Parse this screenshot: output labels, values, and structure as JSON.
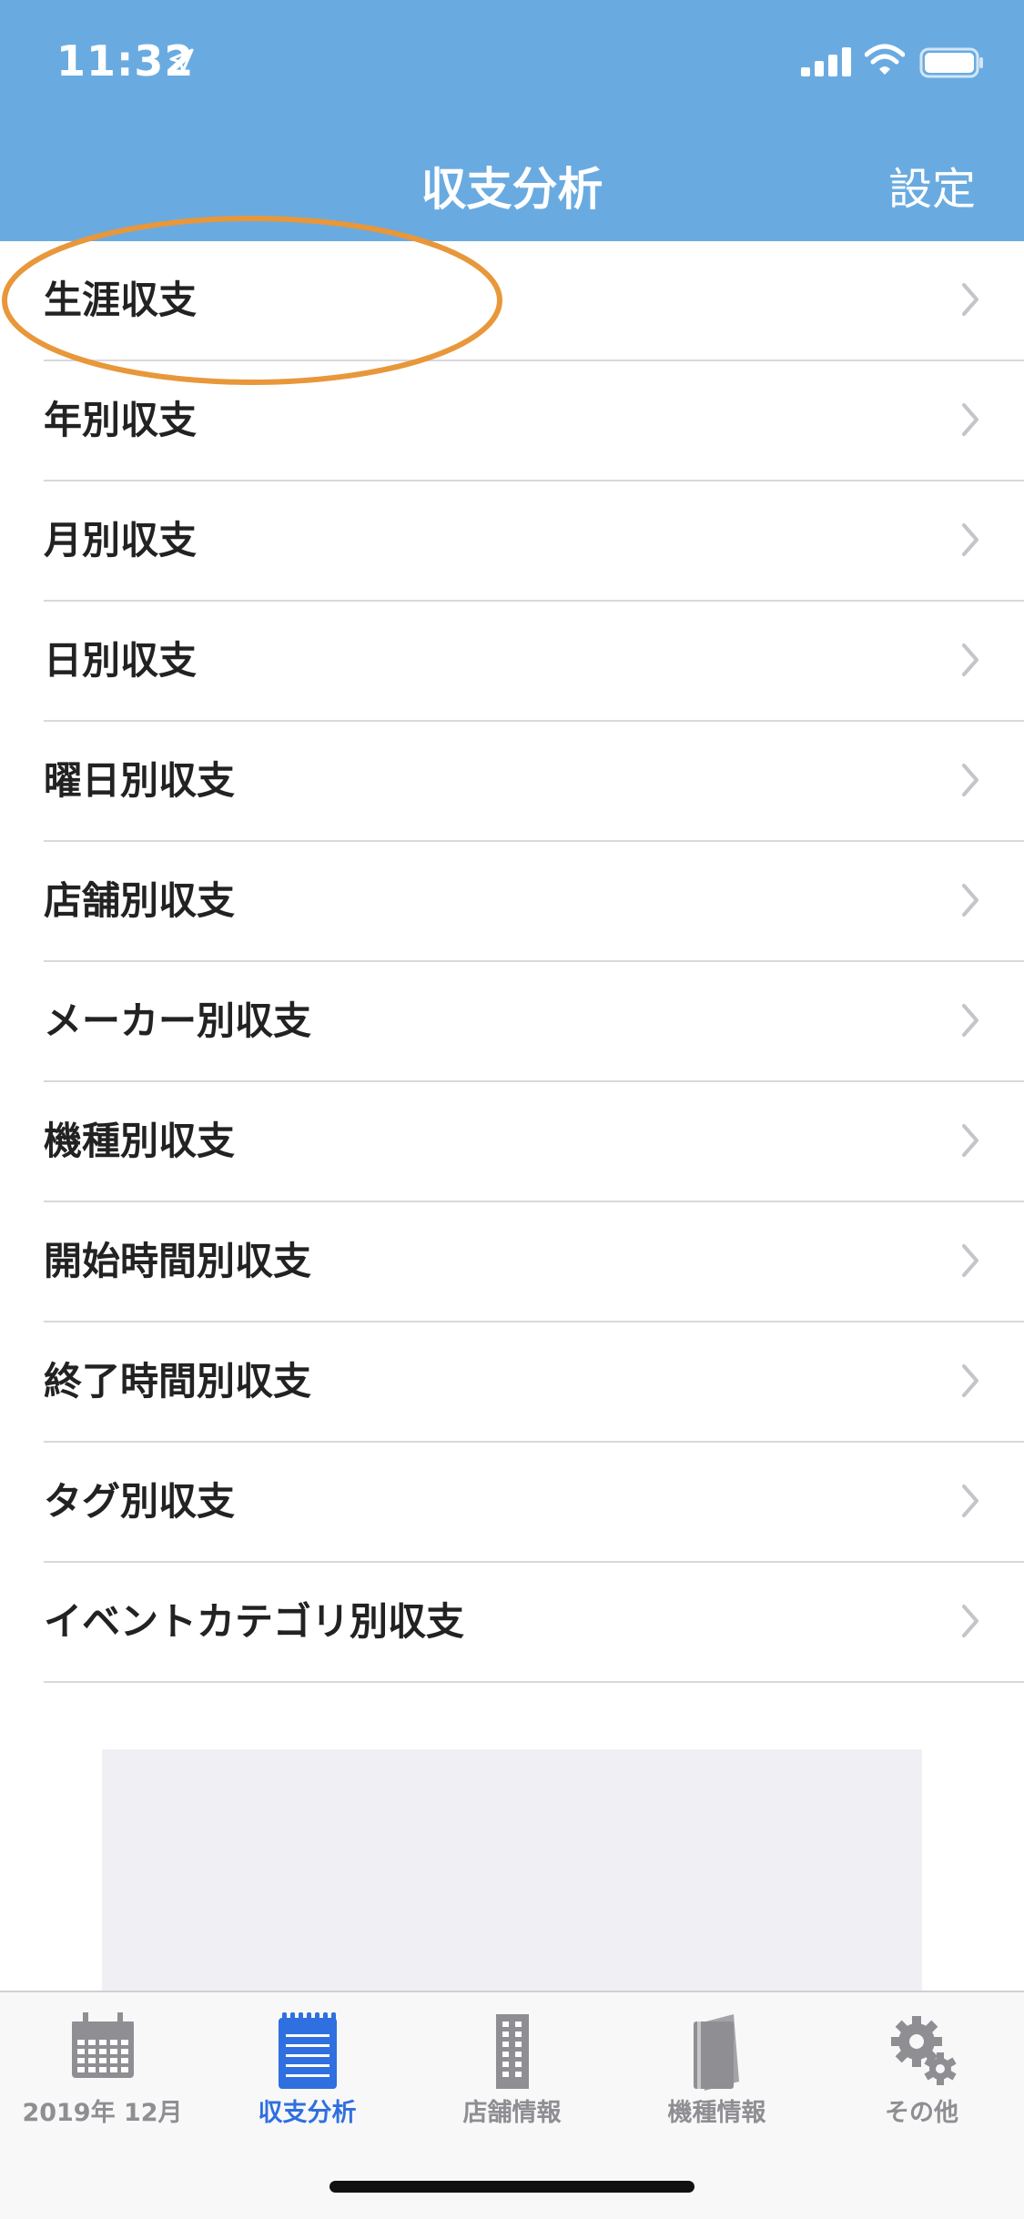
{
  "status": {
    "time": "11:32"
  },
  "nav": {
    "title": "収支分析",
    "settings_label": "設定"
  },
  "list": {
    "items": [
      {
        "label": "生涯収支"
      },
      {
        "label": "年別収支"
      },
      {
        "label": "月別収支"
      },
      {
        "label": "日別収支"
      },
      {
        "label": "曜日別収支"
      },
      {
        "label": "店舗別収支"
      },
      {
        "label": "メーカー別収支"
      },
      {
        "label": "機種別収支"
      },
      {
        "label": "開始時間別収支"
      },
      {
        "label": "終了時間別収支"
      },
      {
        "label": "タグ別収支"
      },
      {
        "label": "イベントカテゴリ別収支"
      }
    ]
  },
  "tabbar": {
    "tabs": [
      {
        "label": "2019年 12月",
        "icon": "calendar-icon",
        "active": false
      },
      {
        "label": "収支分析",
        "icon": "notepad-icon",
        "active": true
      },
      {
        "label": "店舗情報",
        "icon": "building-icon",
        "active": false
      },
      {
        "label": "機種情報",
        "icon": "book-icon",
        "active": false
      },
      {
        "label": "その他",
        "icon": "gear-icon",
        "active": false
      }
    ]
  },
  "colors": {
    "nav_background": "#69ABE1",
    "highlight_ellipse": "#E8973A",
    "active_tab": "#2F6FE0",
    "inactive_tab": "#8E8E93"
  }
}
